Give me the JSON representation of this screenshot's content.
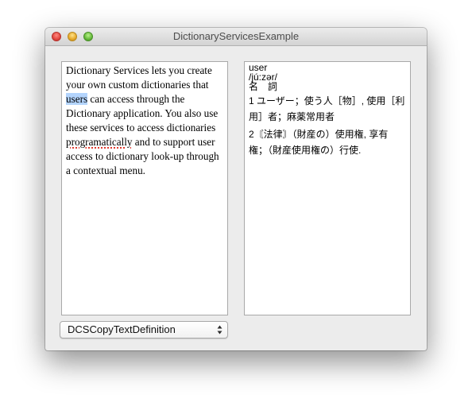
{
  "window": {
    "title": "DictionaryServicesExample"
  },
  "source": {
    "segments": [
      "Dictionary Services lets you create your own custom dictionaries that ",
      "users",
      " can access through the Dictionary application. You also use these services to access dictionaries ",
      "programatically",
      " and to support user access to dictionary look-up through a contextual menu."
    ],
    "selected_word": "users",
    "misspelled_word": "programatically"
  },
  "definition": {
    "headword": "user",
    "pronunciation": "/jú:zər/",
    "part_of_speech": "名　詞",
    "senses": [
      "1 ユーザー；使う人［物］, 使用［利用］者；麻薬常用者",
      "2〘法律〙（財産の）使用権, 享有権；（財産使用権の）行使."
    ]
  },
  "popup": {
    "selected": "DCSCopyTextDefinition"
  },
  "icons": {
    "close": "close-button-icon",
    "minimize": "minimize-button-icon",
    "zoom": "zoom-button-icon",
    "popup_arrows": "updown-arrows-icon"
  },
  "colors": {
    "selection": "#b3d4fd",
    "spelling_underline": "#e0392f",
    "close": "#e2463f",
    "minimize": "#e6a82a",
    "zoom": "#64b83a"
  }
}
